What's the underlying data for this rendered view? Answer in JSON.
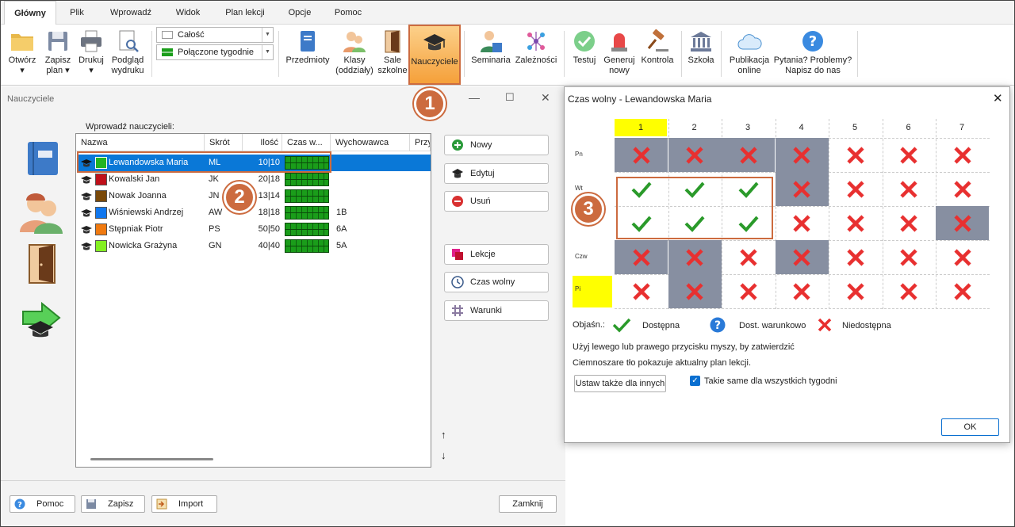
{
  "tabs": [
    "Główny",
    "Plik",
    "Wprowadź",
    "Widok",
    "Plan lekcji",
    "Opcje",
    "Pomoc"
  ],
  "ribbon": {
    "otworz": "Otwórz\n▾",
    "zapisz": "Zapisz\nplan ▾",
    "drukuj": "Drukuj\n▾",
    "podglad": "Podgląd\nwydruku",
    "combo1": "Całość",
    "combo2": "Połączone tygodnie",
    "przedmioty": "Przedmioty",
    "klasy": "Klasy\n(oddziały)",
    "sale": "Sale\nszkolne",
    "nauczyciele": "Nauczyciele",
    "seminaria": "Seminaria",
    "zaleznosci": "Zależności",
    "testuj": "Testuj",
    "generuj": "Generuj\nnowy",
    "kontrola": "Kontrola",
    "szkola": "Szkoła",
    "publikacja": "Publikacja\nonline",
    "pytania": "Pytania? Problemy?\nNapisz do nas"
  },
  "left_window": {
    "title": "Nauczyciele",
    "section_label": "Wprowadź nauczycieli:",
    "columns": [
      "Nazwa",
      "Skrót",
      "Ilość",
      "Czas w...",
      "Wychowawca",
      "Przy"
    ],
    "rows": [
      {
        "name": "Lewandowska Maria",
        "abbr": "ML",
        "count": "10|10",
        "class": "",
        "color": "#22b422",
        "selected": true
      },
      {
        "name": "Kowalski Jan",
        "abbr": "JK",
        "count": "20|18",
        "class": "",
        "color": "#c0101a",
        "selected": false
      },
      {
        "name": "Nowak Joanna",
        "abbr": "JN",
        "count": "13|14",
        "class": "",
        "color": "#7a4a0a",
        "selected": false
      },
      {
        "name": "Wiśniewski Andrzej",
        "abbr": "AW",
        "count": "18|18",
        "class": "1B",
        "color": "#1077ee",
        "selected": false
      },
      {
        "name": "Stępniak Piotr",
        "abbr": "PS",
        "count": "50|50",
        "class": "6A",
        "color": "#f07a10",
        "selected": false
      },
      {
        "name": "Nowicka Grażyna",
        "abbr": "GN",
        "count": "40|40",
        "class": "5A",
        "color": "#84f022",
        "selected": false
      }
    ],
    "buttons": {
      "nowy": "Nowy",
      "edytuj": "Edytuj",
      "usun": "Usuń",
      "lekcje": "Lekcje",
      "czas": "Czas wolny",
      "warunki": "Warunki"
    },
    "bottom": {
      "pomoc": "Pomoc",
      "zapisz": "Zapisz",
      "import": "Import",
      "zamknij": "Zamknij"
    }
  },
  "right_window": {
    "title": "Czas wolny - Lewandowska Maria",
    "cols": [
      "1",
      "2",
      "3",
      "4",
      "5",
      "6",
      "7"
    ],
    "days": [
      "Pn",
      "Wt",
      "",
      "Czw",
      "Pi"
    ],
    "grid": [
      [
        "XD",
        "XD",
        "XD",
        "XD",
        "X",
        "X",
        "X"
      ],
      [
        "V",
        "V",
        "V",
        "XD",
        "X",
        "X",
        "X"
      ],
      [
        "V",
        "V",
        "V",
        "X",
        "X",
        "X",
        "XD"
      ],
      [
        "XD",
        "XD",
        "X",
        "XD",
        "X",
        "X",
        "X"
      ],
      [
        "X",
        "XD",
        "X",
        "X",
        "X",
        "X",
        "X"
      ]
    ],
    "legend_label": "Objaśn.:",
    "legend_avail": "Dostępna",
    "legend_cond": "Dost. warunkowo",
    "legend_unavail": "Niedostępna",
    "hint1": "Użyj lewego lub prawego przycisku myszy, by zatwierdzić",
    "hint2": "Ciemnoszare tło pokazuje aktualny plan lekcji.",
    "btn_other": "Ustaw także dla innych",
    "chk_label": "Takie same dla wszystkich tygodni",
    "ok": "OK"
  },
  "callouts": [
    "1",
    "2",
    "3"
  ],
  "colors": {
    "accent": "#cc6b3f",
    "selected": "#0a78d7",
    "dark_cell": "#878fa1",
    "yellow": "#ffff00"
  }
}
